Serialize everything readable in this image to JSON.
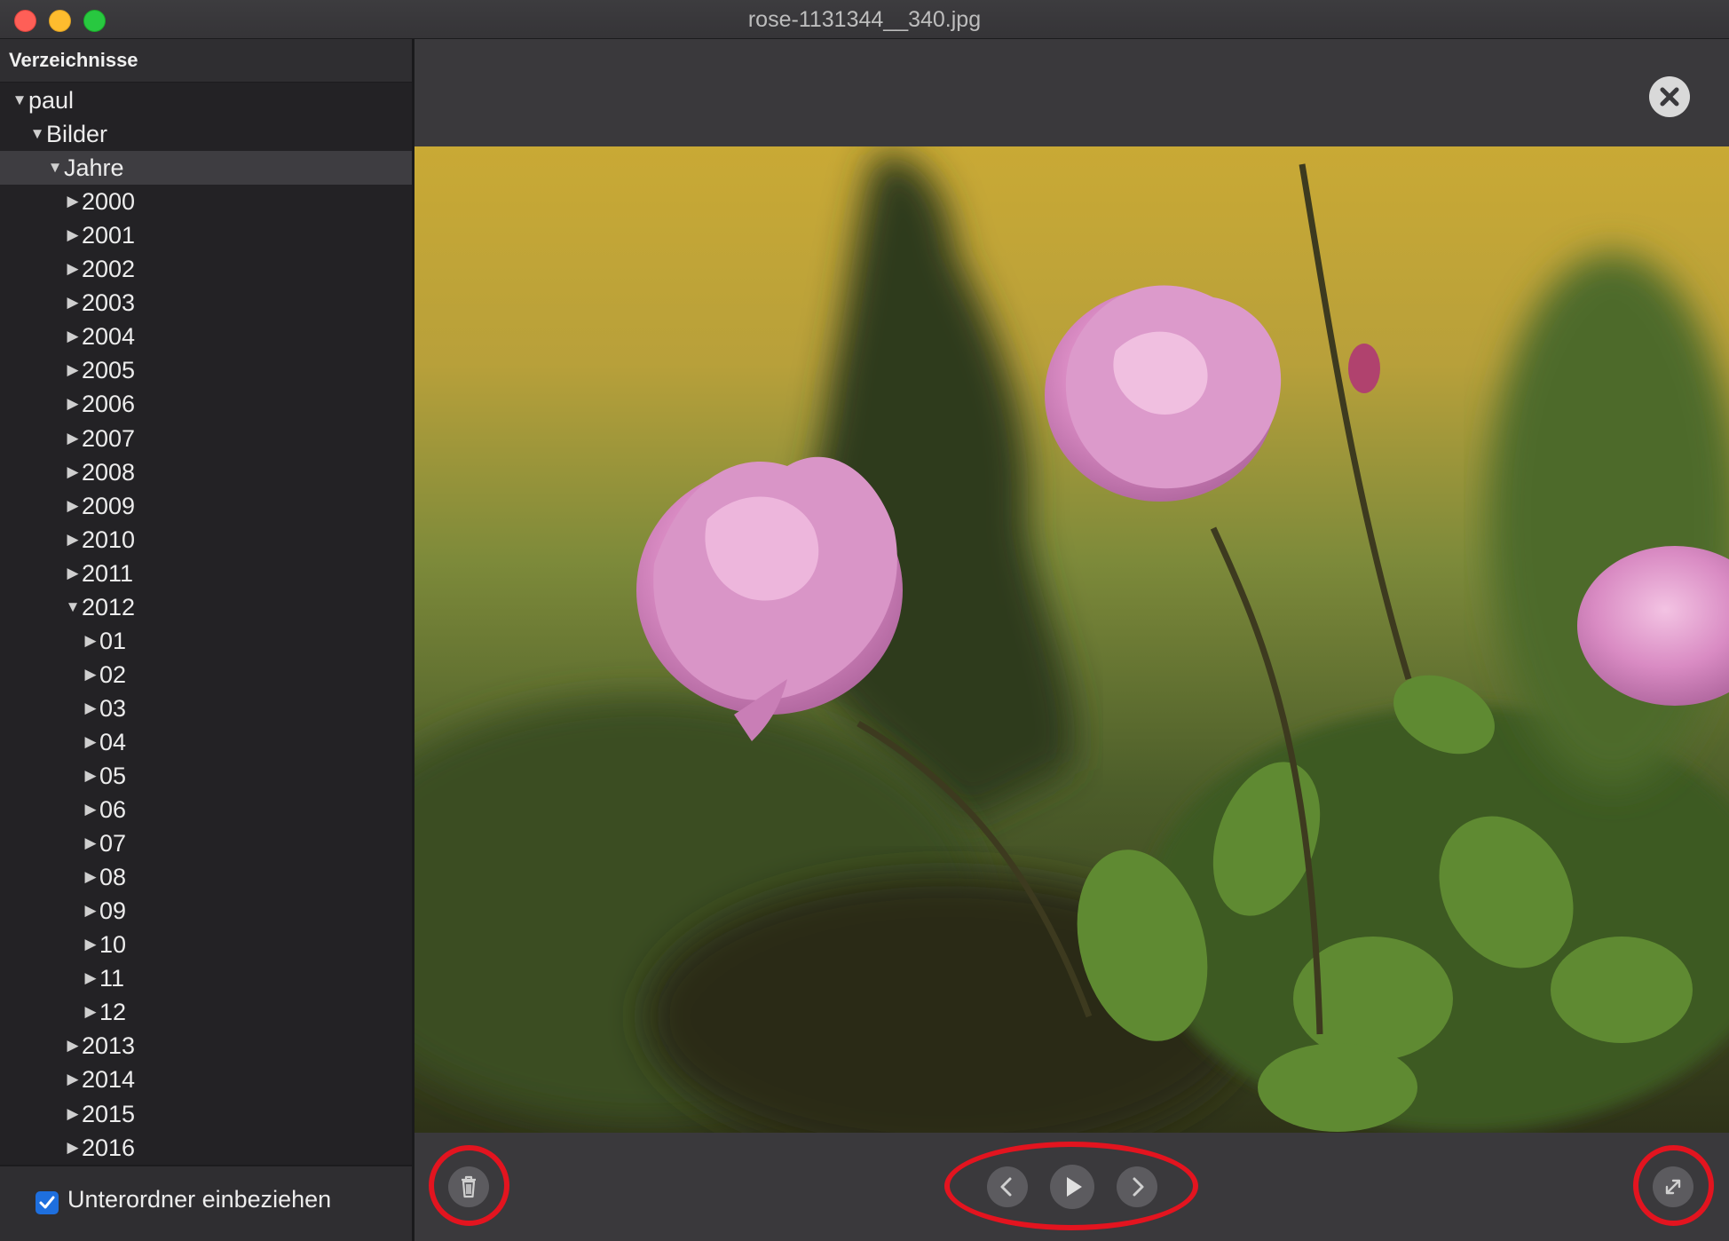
{
  "window": {
    "title": "rose-1131344__340.jpg"
  },
  "sidebar": {
    "header": "Verzeichnisse",
    "tree": [
      {
        "label": "paul",
        "level": 0,
        "expanded": true
      },
      {
        "label": "Bilder",
        "level": 1,
        "expanded": true
      },
      {
        "label": "Jahre",
        "level": 2,
        "expanded": true,
        "selected": true
      },
      {
        "label": "2000",
        "level": 3,
        "expanded": false
      },
      {
        "label": "2001",
        "level": 3,
        "expanded": false
      },
      {
        "label": "2002",
        "level": 3,
        "expanded": false
      },
      {
        "label": "2003",
        "level": 3,
        "expanded": false
      },
      {
        "label": "2004",
        "level": 3,
        "expanded": false
      },
      {
        "label": "2005",
        "level": 3,
        "expanded": false
      },
      {
        "label": "2006",
        "level": 3,
        "expanded": false
      },
      {
        "label": "2007",
        "level": 3,
        "expanded": false
      },
      {
        "label": "2008",
        "level": 3,
        "expanded": false
      },
      {
        "label": "2009",
        "level": 3,
        "expanded": false
      },
      {
        "label": "2010",
        "level": 3,
        "expanded": false
      },
      {
        "label": "2011",
        "level": 3,
        "expanded": false
      },
      {
        "label": "2012",
        "level": 3,
        "expanded": true
      },
      {
        "label": "01",
        "level": 4,
        "expanded": false
      },
      {
        "label": "02",
        "level": 4,
        "expanded": false
      },
      {
        "label": "03",
        "level": 4,
        "expanded": false
      },
      {
        "label": "04",
        "level": 4,
        "expanded": false
      },
      {
        "label": "05",
        "level": 4,
        "expanded": false
      },
      {
        "label": "06",
        "level": 4,
        "expanded": false
      },
      {
        "label": "07",
        "level": 4,
        "expanded": false
      },
      {
        "label": "08",
        "level": 4,
        "expanded": false
      },
      {
        "label": "09",
        "level": 4,
        "expanded": false
      },
      {
        "label": "10",
        "level": 4,
        "expanded": false
      },
      {
        "label": "11",
        "level": 4,
        "expanded": false
      },
      {
        "label": "12",
        "level": 4,
        "expanded": false
      },
      {
        "label": "2013",
        "level": 3,
        "expanded": false
      },
      {
        "label": "2014",
        "level": 3,
        "expanded": false
      },
      {
        "label": "2015",
        "level": 3,
        "expanded": false
      },
      {
        "label": "2016",
        "level": 3,
        "expanded": false
      }
    ],
    "include_subfolders": {
      "label": "Unterordner einbeziehen",
      "checked": true
    }
  },
  "viewer": {
    "controls": {
      "close": "close-icon",
      "delete": "trash-icon",
      "previous": "chevron-left-icon",
      "play": "play-icon",
      "next": "chevron-right-icon",
      "fullscreen": "expand-icon"
    }
  },
  "colors": {
    "highlight_ring": "#e3141f",
    "checkbox": "#1e6fde",
    "selection": "#3e3d41"
  }
}
